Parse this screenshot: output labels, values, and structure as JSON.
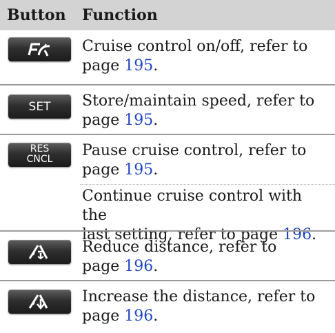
{
  "header": {
    "col1": "Button",
    "col2": "Function"
  },
  "rows": [
    {
      "button": {
        "icon": "cruise-control-icon"
      },
      "lines": [
        {
          "pre": "Cruise control on/off, refer to",
          "pre2": "page ",
          "page": "195",
          "post": "."
        }
      ]
    },
    {
      "button": {
        "label": "SET"
      },
      "lines": [
        {
          "pre": "Store/maintain speed, refer to",
          "pre2": "page ",
          "page": "195",
          "post": "."
        }
      ]
    },
    {
      "button": {
        "label1": "RES",
        "label2": "CNCL"
      },
      "lines": [
        {
          "pre": "Pause cruise control, refer to",
          "pre2": "page ",
          "page": "195",
          "post": "."
        },
        {
          "pre": "Continue cruise control with the",
          "pre2": "last setting, refer to page ",
          "page": "196",
          "post": "."
        }
      ]
    },
    {
      "button": {
        "icon": "distance-decrease-icon"
      },
      "lines": [
        {
          "pre": "Reduce distance, refer to",
          "pre2": "page ",
          "page": "196",
          "post": "."
        }
      ]
    },
    {
      "button": {
        "icon": "distance-increase-icon"
      },
      "lines": [
        {
          "pre": "Increase the distance, refer to",
          "pre2": "page ",
          "page": "196",
          "post": "."
        }
      ]
    }
  ],
  "colors": {
    "header_bg": "#d3d3d3",
    "link": "#1f45c4",
    "button_dark": "#2f2f2f"
  }
}
